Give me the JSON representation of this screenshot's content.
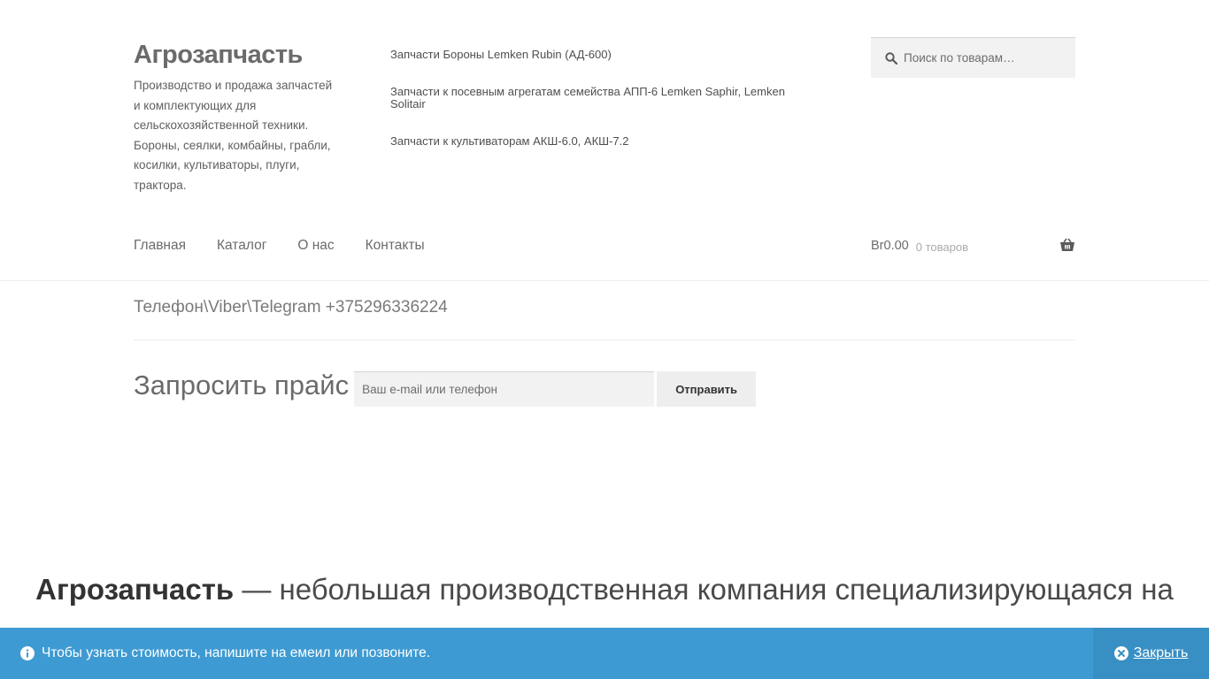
{
  "site": {
    "title": "Агрозапчасть",
    "description": "Производство и продажа запчастей и комплектующих для сельскохозяйственной техники. Бороны, сеялки, комбайны, грабли, косилки, культиваторы, плуги, трактора."
  },
  "top_links": [
    {
      "label": "Запчасти Бороны Lemken Rubin (АД-600)"
    },
    {
      "label": "Запчасти к посевным агрегатам семейства АПП-6 Lemken Saphir, Lemken Solitair"
    },
    {
      "label": "Запчасти к культиваторам АКШ-6.0, АКШ-7.2"
    }
  ],
  "search": {
    "placeholder": "Поиск по товарам…",
    "icon": "search-icon"
  },
  "nav": [
    {
      "label": "Главная"
    },
    {
      "label": "Каталог"
    },
    {
      "label": "О нас"
    },
    {
      "label": "Контакты"
    }
  ],
  "cart": {
    "amount": "Br0.00",
    "count": "0 товаров",
    "icon": "basket-icon"
  },
  "phone": "Телефон\\Viber\\Telegram +375296336224",
  "price_request": {
    "label": "Запросить прайс",
    "placeholder": "Ваш e-mail или телефон",
    "button": "Отправить"
  },
  "intro": {
    "bold": "Агрозапчасть",
    "text": " — небольшая производственная компания специализирующаяся на"
  },
  "notice": {
    "text": "Чтобы узнать стоимость, напишите на емеил или позвоните.",
    "close_label": "Закрыть",
    "background": "#3e9ad2"
  }
}
